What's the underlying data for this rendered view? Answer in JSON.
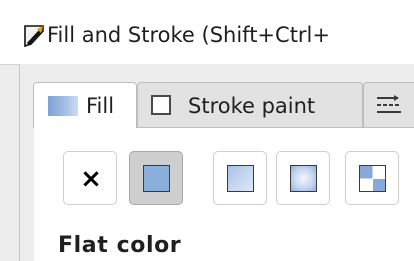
{
  "dialog": {
    "title": "Fill and Stroke (Shift+Ctrl+",
    "icon": "fill-stroke-brush-icon"
  },
  "tabs": [
    {
      "label": "Fill",
      "icon": "fill-icon",
      "active": true
    },
    {
      "label": "Stroke paint",
      "icon": "stroke-paint-icon",
      "active": false
    },
    {
      "label": "",
      "icon": "stroke-style-icon",
      "active": false
    }
  ],
  "paint_modes": [
    {
      "name": "No paint",
      "glyph": "×",
      "selected": false
    },
    {
      "name": "Flat color",
      "icon": "flat-color-icon",
      "selected": true
    },
    {
      "name": "Linear gradient",
      "icon": "linear-gradient-icon",
      "selected": false
    },
    {
      "name": "Radial gradient",
      "icon": "radial-gradient-icon",
      "selected": false
    },
    {
      "name": "Pattern",
      "icon": "pattern-icon",
      "selected": false
    }
  ],
  "section": {
    "title": "Flat color"
  },
  "colors": {
    "selected_button_bg": "#cfcfcf",
    "fill_blue": "#8aafdb"
  }
}
